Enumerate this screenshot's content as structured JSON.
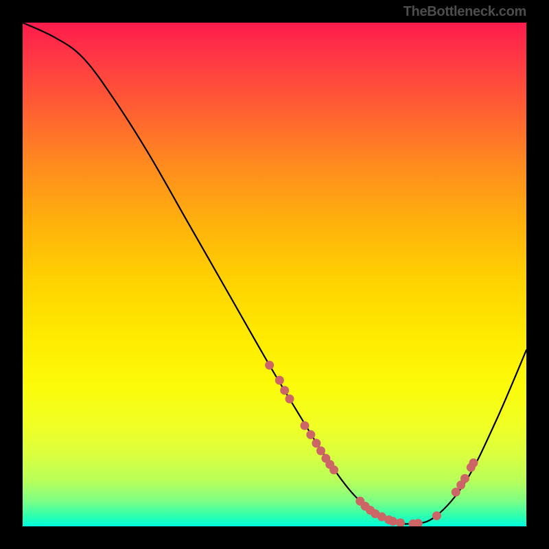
{
  "attribution": "TheBottleneck.com",
  "chart_data": {
    "type": "line",
    "title": "",
    "xlabel": "",
    "ylabel": "",
    "xlim": [
      0,
      100
    ],
    "ylim": [
      0,
      100
    ],
    "curve": [
      {
        "x": 0,
        "y": 100
      },
      {
        "x": 6.5,
        "y": 97
      },
      {
        "x": 12,
        "y": 93
      },
      {
        "x": 18,
        "y": 85
      },
      {
        "x": 25,
        "y": 74
      },
      {
        "x": 33,
        "y": 60
      },
      {
        "x": 41,
        "y": 46
      },
      {
        "x": 49,
        "y": 32
      },
      {
        "x": 55,
        "y": 22
      },
      {
        "x": 60,
        "y": 14
      },
      {
        "x": 66,
        "y": 6
      },
      {
        "x": 72,
        "y": 1.5
      },
      {
        "x": 77,
        "y": 0.5
      },
      {
        "x": 82,
        "y": 2
      },
      {
        "x": 88,
        "y": 9
      },
      {
        "x": 94,
        "y": 21
      },
      {
        "x": 100,
        "y": 35
      }
    ],
    "markers": [
      {
        "x": 49,
        "y": 32
      },
      {
        "x": 51,
        "y": 29
      },
      {
        "x": 52,
        "y": 27
      },
      {
        "x": 53,
        "y": 25.3
      },
      {
        "x": 56,
        "y": 20
      },
      {
        "x": 57.2,
        "y": 18.2
      },
      {
        "x": 58.3,
        "y": 16.5
      },
      {
        "x": 59.2,
        "y": 15
      },
      {
        "x": 60.2,
        "y": 13.5
      },
      {
        "x": 61,
        "y": 12.3
      },
      {
        "x": 61.8,
        "y": 11.2
      },
      {
        "x": 67,
        "y": 5
      },
      {
        "x": 68,
        "y": 4
      },
      {
        "x": 69,
        "y": 3.2
      },
      {
        "x": 70,
        "y": 2.5
      },
      {
        "x": 71.3,
        "y": 1.9
      },
      {
        "x": 72.7,
        "y": 1.3
      },
      {
        "x": 73.5,
        "y": 1
      },
      {
        "x": 75,
        "y": 0.7
      },
      {
        "x": 77.5,
        "y": 0.5
      },
      {
        "x": 78.5,
        "y": 0.6
      },
      {
        "x": 82.2,
        "y": 2.1
      },
      {
        "x": 86,
        "y": 6.8
      },
      {
        "x": 87,
        "y": 8.2
      },
      {
        "x": 87.8,
        "y": 9.5
      },
      {
        "x": 89,
        "y": 11.7
      },
      {
        "x": 89.5,
        "y": 12.6
      }
    ],
    "marker_color": "#cc6666",
    "line_color": "#000000"
  }
}
